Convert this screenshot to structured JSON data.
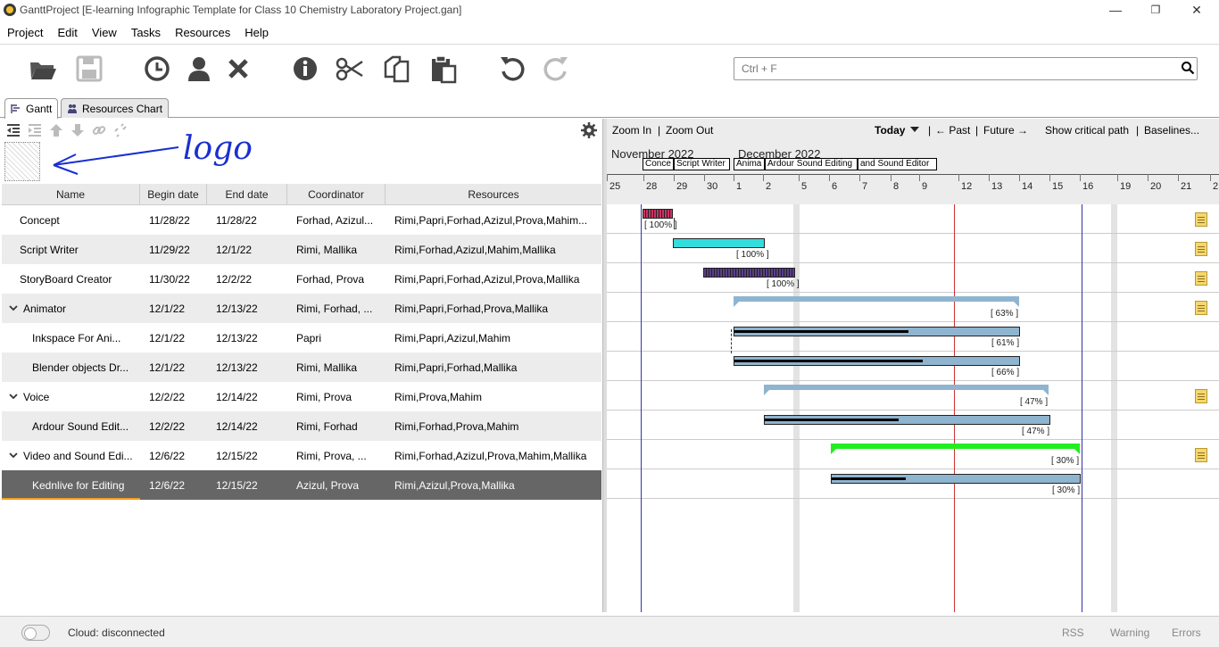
{
  "window": {
    "title": "GanttProject [E-learning Infographic Template for Class 10 Chemistry Laboratory Project.gan]",
    "minimize": "—",
    "restore": "❐",
    "close": "✕"
  },
  "menu": [
    {
      "label": "Project"
    },
    {
      "label": "Edit"
    },
    {
      "label": "View"
    },
    {
      "label": "Tasks"
    },
    {
      "label": "Resources"
    },
    {
      "label": "Help"
    }
  ],
  "search": {
    "placeholder": "Ctrl + F"
  },
  "tabs": [
    {
      "label": "Gantt"
    },
    {
      "label": "Resources Chart"
    }
  ],
  "annotation": {
    "text": "logo"
  },
  "grid": {
    "headers": [
      "Name",
      "Begin date",
      "End date",
      "Coordinator",
      "Resources"
    ],
    "rows": [
      {
        "name": "Concept",
        "begin": "11/28/22",
        "end": "11/28/22",
        "coordinator": "Forhad, Azizul...",
        "resources": "Rimi,Papri,Forhad,Azizul,Prova,Mahim...",
        "level": 0,
        "expandable": false
      },
      {
        "name": "Script Writer",
        "begin": "11/29/22",
        "end": "12/1/22",
        "coordinator": "Rimi, Mallika",
        "resources": "Rimi,Forhad,Azizul,Mahim,Mallika",
        "level": 0,
        "expandable": false
      },
      {
        "name": "StoryBoard Creator",
        "begin": "11/30/22",
        "end": "12/2/22",
        "coordinator": "Forhad, Prova",
        "resources": "Rimi,Papri,Forhad,Azizul,Prova,Mallika",
        "level": 0,
        "expandable": false
      },
      {
        "name": "Animator",
        "begin": "12/1/22",
        "end": "12/13/22",
        "coordinator": "Rimi, Forhad, ...",
        "resources": "Rimi,Papri,Forhad,Prova,Mallika",
        "level": 0,
        "expandable": true
      },
      {
        "name": "Inkspace For Ani...",
        "begin": "12/1/22",
        "end": "12/13/22",
        "coordinator": "Papri",
        "resources": "Rimi,Papri,Azizul,Mahim",
        "level": 1,
        "expandable": false
      },
      {
        "name": "Blender objects Dr...",
        "begin": "12/1/22",
        "end": "12/13/22",
        "coordinator": "Rimi, Mallika",
        "resources": "Rimi,Papri,Forhad,Mallika",
        "level": 1,
        "expandable": false
      },
      {
        "name": "Voice",
        "begin": "12/2/22",
        "end": "12/14/22",
        "coordinator": "Rimi, Prova",
        "resources": "Rimi,Prova,Mahim",
        "level": 0,
        "expandable": true
      },
      {
        "name": "Ardour Sound Edit...",
        "begin": "12/2/22",
        "end": "12/14/22",
        "coordinator": "Rimi, Forhad",
        "resources": "Rimi,Forhad,Prova,Mahim",
        "level": 1,
        "expandable": false
      },
      {
        "name": "Video and Sound Edi...",
        "begin": "12/6/22",
        "end": "12/15/22",
        "coordinator": "Rimi, Prova, ...",
        "resources": "Rimi,Forhad,Azizul,Prova,Mahim,Mallika",
        "level": 0,
        "expandable": true
      },
      {
        "name": "Kednlive for Editing",
        "begin": "12/6/22",
        "end": "12/15/22",
        "coordinator": "Azizul, Prova",
        "resources": "Rimi,Azizul,Prova,Mallika",
        "level": 1,
        "expandable": false,
        "selected": true
      }
    ]
  },
  "chart_toolbar": {
    "zoom_in": "Zoom In",
    "sep1": "|",
    "zoom_out": "Zoom Out",
    "today": "Today",
    "sep2": "|",
    "past": "← Past",
    "sep3": "|",
    "future": "Future →",
    "critical": "Show critical path",
    "sep4": "|",
    "baselines": "Baselines..."
  },
  "timeline": {
    "months": [
      "November 2022",
      "December 2022"
    ],
    "days": [
      "25",
      "28",
      "29",
      "30",
      "1",
      "2",
      "5",
      "6",
      "7",
      "8",
      "9",
      "12",
      "13",
      "14",
      "15",
      "16",
      "19",
      "20",
      "21",
      "2"
    ],
    "mini_labels": [
      {
        "text": "Conce",
        "color": "#cc3399"
      },
      {
        "text": "Script Writer",
        "color": "#22cccc"
      },
      {
        "text": "Anima",
        "color": "#8aa7c0"
      },
      {
        "text": "Ardour Sound Editing",
        "color": "#8aa7c0"
      },
      {
        "text": "and Sound Editor",
        "color": "#22cc22"
      }
    ]
  },
  "gantt": {
    "colors": {
      "today_line": "#cc3333",
      "milestone_line": "#3333aa",
      "task": "#8fb4cf",
      "concept": "#cc3366",
      "script": "#33dddd",
      "storyboard": "#5a3f8a",
      "video": "#22ee22"
    },
    "tasks": [
      {
        "pct": "[ 100% ]",
        "progress": 1.0
      },
      {
        "pct": "[ 100% ]",
        "progress": 1.0
      },
      {
        "pct": "[ 100% ]",
        "progress": 1.0
      },
      {
        "pct": "[ 63% ]",
        "progress": 0.63
      },
      {
        "pct": "[ 61% ]",
        "progress": 0.61
      },
      {
        "pct": "[ 66% ]",
        "progress": 0.66
      },
      {
        "pct": "[ 47% ]",
        "progress": 0.47
      },
      {
        "pct": "[ 47% ]",
        "progress": 0.47
      },
      {
        "pct": "[ 30% ]",
        "progress": 0.3
      },
      {
        "pct": "[ 30% ]",
        "progress": 0.3
      }
    ]
  },
  "status": {
    "cloud": "Cloud: disconnected",
    "rss": "RSS",
    "warning": "Warning",
    "errors": "Errors"
  }
}
